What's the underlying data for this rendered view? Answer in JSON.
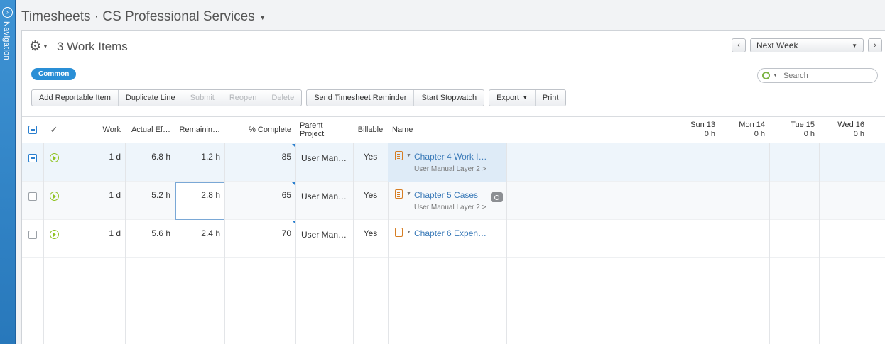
{
  "navigation": {
    "label": "Navigation"
  },
  "title": "Timesheets · CS Professional Services",
  "panel": {
    "count_label": "3 Work Items"
  },
  "week_nav": {
    "prev": "‹",
    "next": "›",
    "selected": "Next Week"
  },
  "filter": {
    "pill": "Common"
  },
  "search": {
    "placeholder": "Search"
  },
  "toolbar": {
    "group1": [
      {
        "label": "Add Reportable Item",
        "enabled": true
      },
      {
        "label": "Duplicate Line",
        "enabled": true
      },
      {
        "label": "Submit",
        "enabled": false
      },
      {
        "label": "Reopen",
        "enabled": false
      },
      {
        "label": "Delete",
        "enabled": false
      }
    ],
    "group2": [
      {
        "label": "Send Timesheet Reminder",
        "enabled": true
      },
      {
        "label": "Start Stopwatch",
        "enabled": true
      }
    ],
    "group3": [
      {
        "label": "Export",
        "enabled": true
      },
      {
        "label": "Print",
        "enabled": true
      }
    ]
  },
  "grid": {
    "headers": {
      "check": "✓",
      "work": "Work",
      "actual": "Actual Ef…",
      "remaining": "Remainin…",
      "complete": "% Complete",
      "parent": "Parent Project",
      "billable": "Billable",
      "name": "Name"
    },
    "days": [
      {
        "day": "Sun 13",
        "hours": "0 h"
      },
      {
        "day": "Mon 14",
        "hours": "0 h"
      },
      {
        "day": "Tue 15",
        "hours": "0 h"
      },
      {
        "day": "Wed 16",
        "hours": "0 h"
      }
    ],
    "rows": [
      {
        "work": "1 d",
        "actual": "6.8 h",
        "remaining": "1.2 h",
        "complete": "85",
        "parent": "User Man…",
        "billable": "Yes",
        "name": "Chapter 4 Work I…",
        "sub": "User Manual Layer 2 >"
      },
      {
        "work": "1 d",
        "actual": "5.2 h",
        "remaining": "2.8 h",
        "complete": "65",
        "parent": "User Man…",
        "billable": "Yes",
        "name": "Chapter 5 Cases",
        "sub": "User Manual Layer 2 >"
      },
      {
        "work": "1 d",
        "actual": "5.6 h",
        "remaining": "2.4 h",
        "complete": "70",
        "parent": "User Man…",
        "billable": "Yes",
        "name": "Chapter 6 Expen…",
        "sub": ""
      }
    ]
  }
}
